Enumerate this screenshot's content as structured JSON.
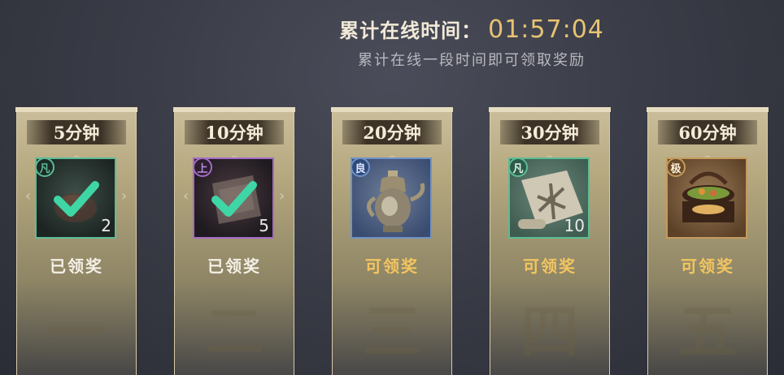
{
  "header": {
    "title_label": "累计在线时间：",
    "title_time": "01:57:04",
    "subtitle": "累计在线一段时间即可领取奖励"
  },
  "cards": [
    {
      "time": "5分钟",
      "grade": "凡",
      "grade_color": "#5bbd95",
      "quantity": "2",
      "status": "已领奖",
      "state": "claimed",
      "numeral": "一",
      "item_icon": "bundle-icon"
    },
    {
      "time": "10分钟",
      "grade": "上",
      "grade_color": "#a46bc8",
      "quantity": "5",
      "status": "已领奖",
      "state": "claimed",
      "numeral": "二",
      "item_icon": "scroll-icon"
    },
    {
      "time": "20分钟",
      "grade": "良",
      "grade_color": "#6f93c8",
      "quantity": "",
      "status": "可领奖",
      "state": "claimable",
      "numeral": "三",
      "item_icon": "teapot-icon"
    },
    {
      "time": "30分钟",
      "grade": "凡",
      "grade_color": "#5bbd95",
      "quantity": "10",
      "status": "可领奖",
      "state": "claimable",
      "numeral": "四",
      "item_icon": "map-scroll-icon"
    },
    {
      "time": "60分钟",
      "grade": "极",
      "grade_color": "#c49a5c",
      "quantity": "",
      "status": "可领奖",
      "state": "claimable",
      "numeral": "五",
      "item_icon": "food-box-icon"
    }
  ],
  "colors": {
    "claimed_text": "#f4efe6",
    "claimable_text": "#f2c560",
    "timer": "#e8c372",
    "check": "#3fd6a6"
  }
}
